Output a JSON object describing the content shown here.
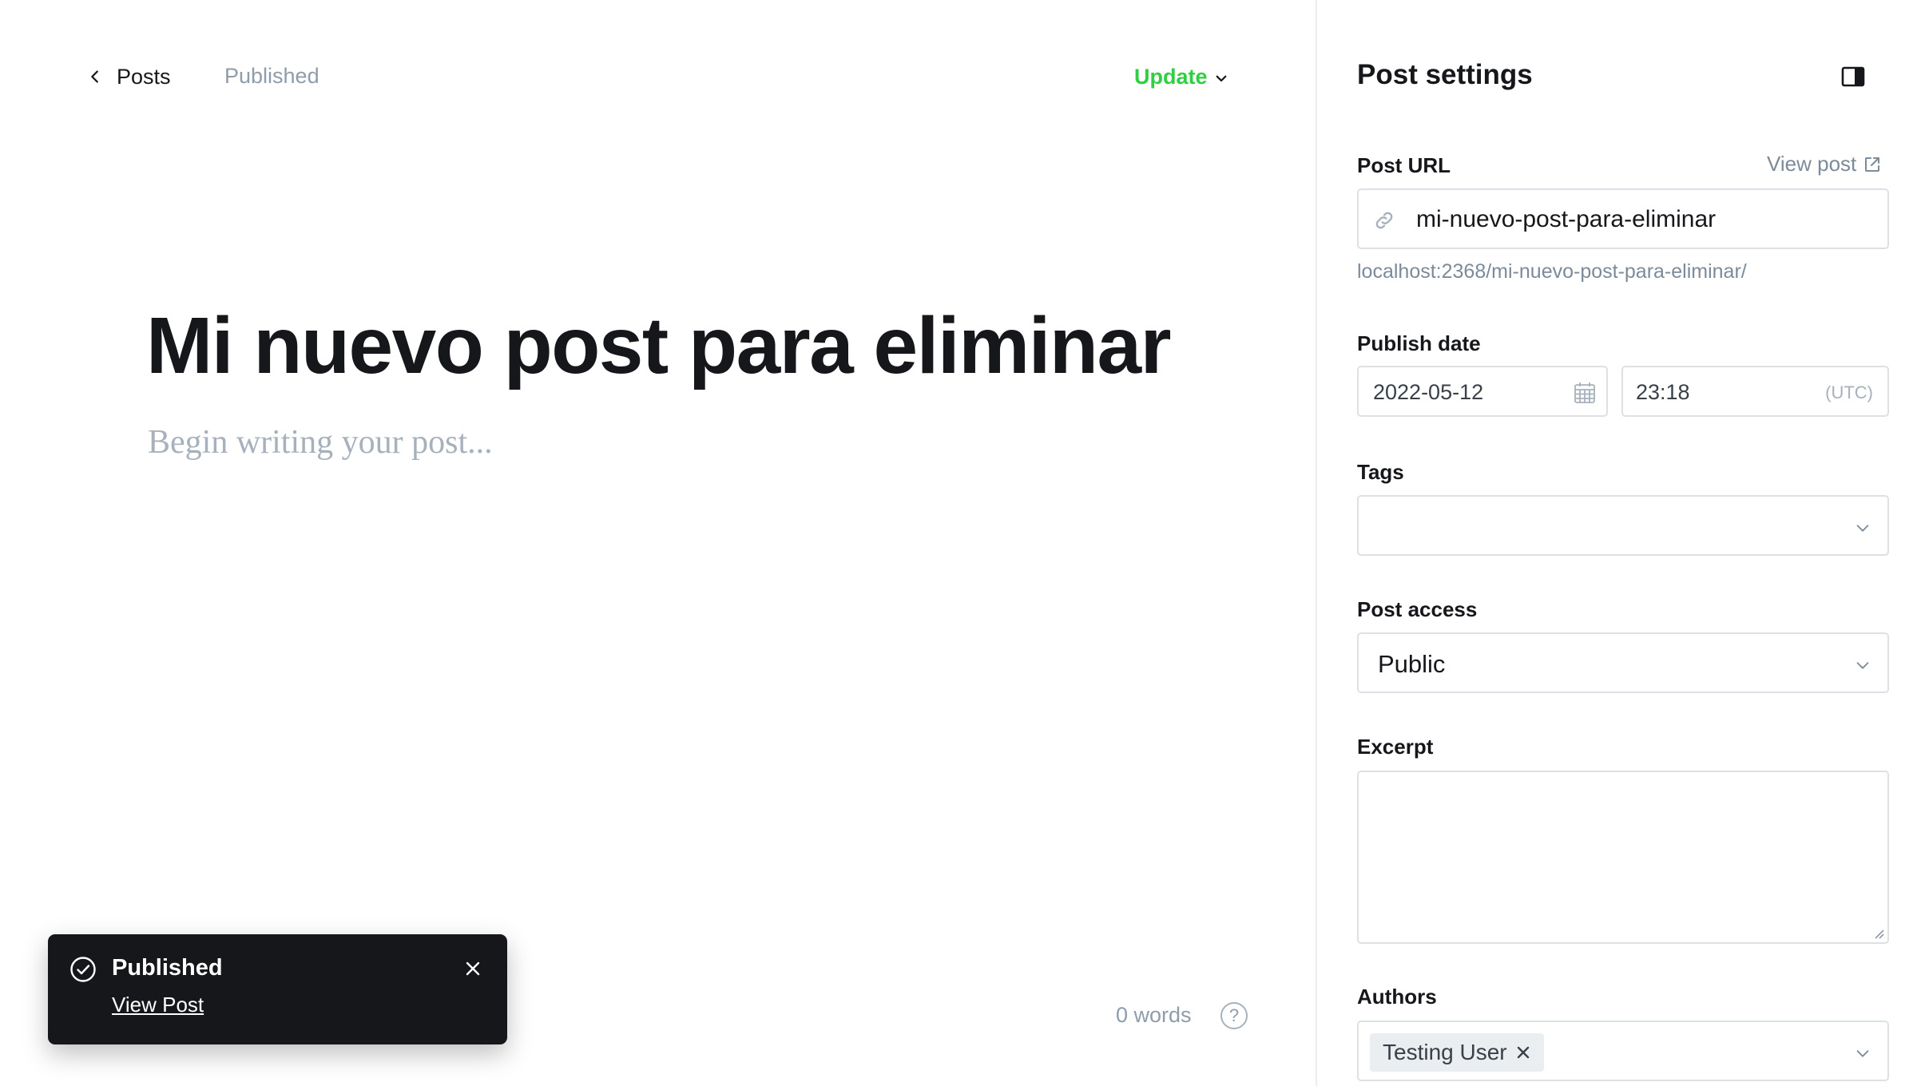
{
  "topbar": {
    "back_label": "Posts",
    "status": "Published",
    "update_label": "Update"
  },
  "post": {
    "title": "Mi nuevo post para eliminar",
    "body_placeholder": "Begin writing your post...",
    "word_count": "0 words",
    "help_glyph": "?"
  },
  "toast": {
    "title": "Published",
    "link": "View Post"
  },
  "settings": {
    "title": "Post settings",
    "post_url": {
      "label": "Post URL",
      "view_post": "View post",
      "value": "mi-nuevo-post-para-eliminar",
      "full_url": "localhost:2368/mi-nuevo-post-para-eliminar/"
    },
    "publish_date": {
      "label": "Publish date",
      "date": "2022-05-12",
      "time": "23:18",
      "timezone": "(UTC)"
    },
    "tags": {
      "label": "Tags",
      "value": ""
    },
    "post_access": {
      "label": "Post access",
      "value": "Public"
    },
    "excerpt": {
      "label": "Excerpt",
      "value": ""
    },
    "authors": {
      "label": "Authors",
      "items": [
        "Testing User"
      ]
    }
  },
  "colors": {
    "accent_green": "#30cf43",
    "toast_bg": "#15171a",
    "muted": "#8e9cac",
    "border": "#dde1e5"
  },
  "icons": [
    "chevron-left-icon",
    "chevron-down-icon",
    "help-icon",
    "check-circle-icon",
    "close-icon",
    "sidebar-toggle-icon",
    "external-link-icon",
    "link-icon",
    "calendar-icon"
  ]
}
